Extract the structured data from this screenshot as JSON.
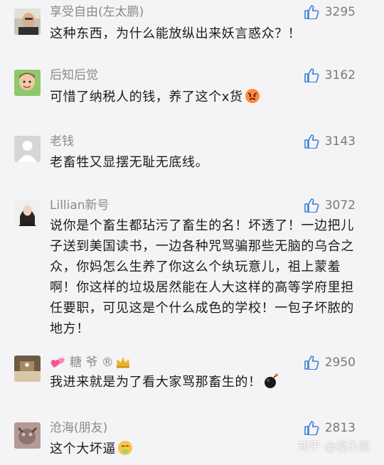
{
  "comments": [
    {
      "username": "享受自由(左太鹏)",
      "likes": "3295",
      "text": "这种东西，为什么能放纵出来妖言惑众？！"
    },
    {
      "username": "后知后觉",
      "likes": "3162",
      "text": "可惜了纳税人的钱，养了这个x货",
      "emoji": "angry-face"
    },
    {
      "username": "老钱",
      "likes": "3143",
      "text": "老畜牲又显摆无耻无底线。"
    },
    {
      "username": "Lillian新号",
      "likes": "3072",
      "text": "说你是个畜生都玷污了畜生的名！坏透了！一边把儿子送到美国读书，一边各种咒骂骗那些无脑的乌合之众，你妈怎么生养了你这么个纨玩意儿，祖上蒙羞啊！你这样的垃圾居然能在人大这样的高等学府里担任要职，可见这是个什么成色的学校！一包子坏脓的地方！"
    },
    {
      "username": "糖 爷 ®",
      "username_decorations": [
        "heart-emoji",
        "crown-emoji"
      ],
      "likes": "2950",
      "text": "我进来就是为了看大家骂那畜生的！",
      "emoji": "bomb"
    },
    {
      "username": "沧海(朋友)",
      "likes": "2813",
      "text": "这个大坏逼",
      "emoji": "sick-face"
    }
  ],
  "watermark": "知乎 @福乐强",
  "colors": {
    "background": "#f4f4f6",
    "thumb": "#3b7fd6",
    "username": "#8a8a8a",
    "text": "#1b1b1b"
  }
}
